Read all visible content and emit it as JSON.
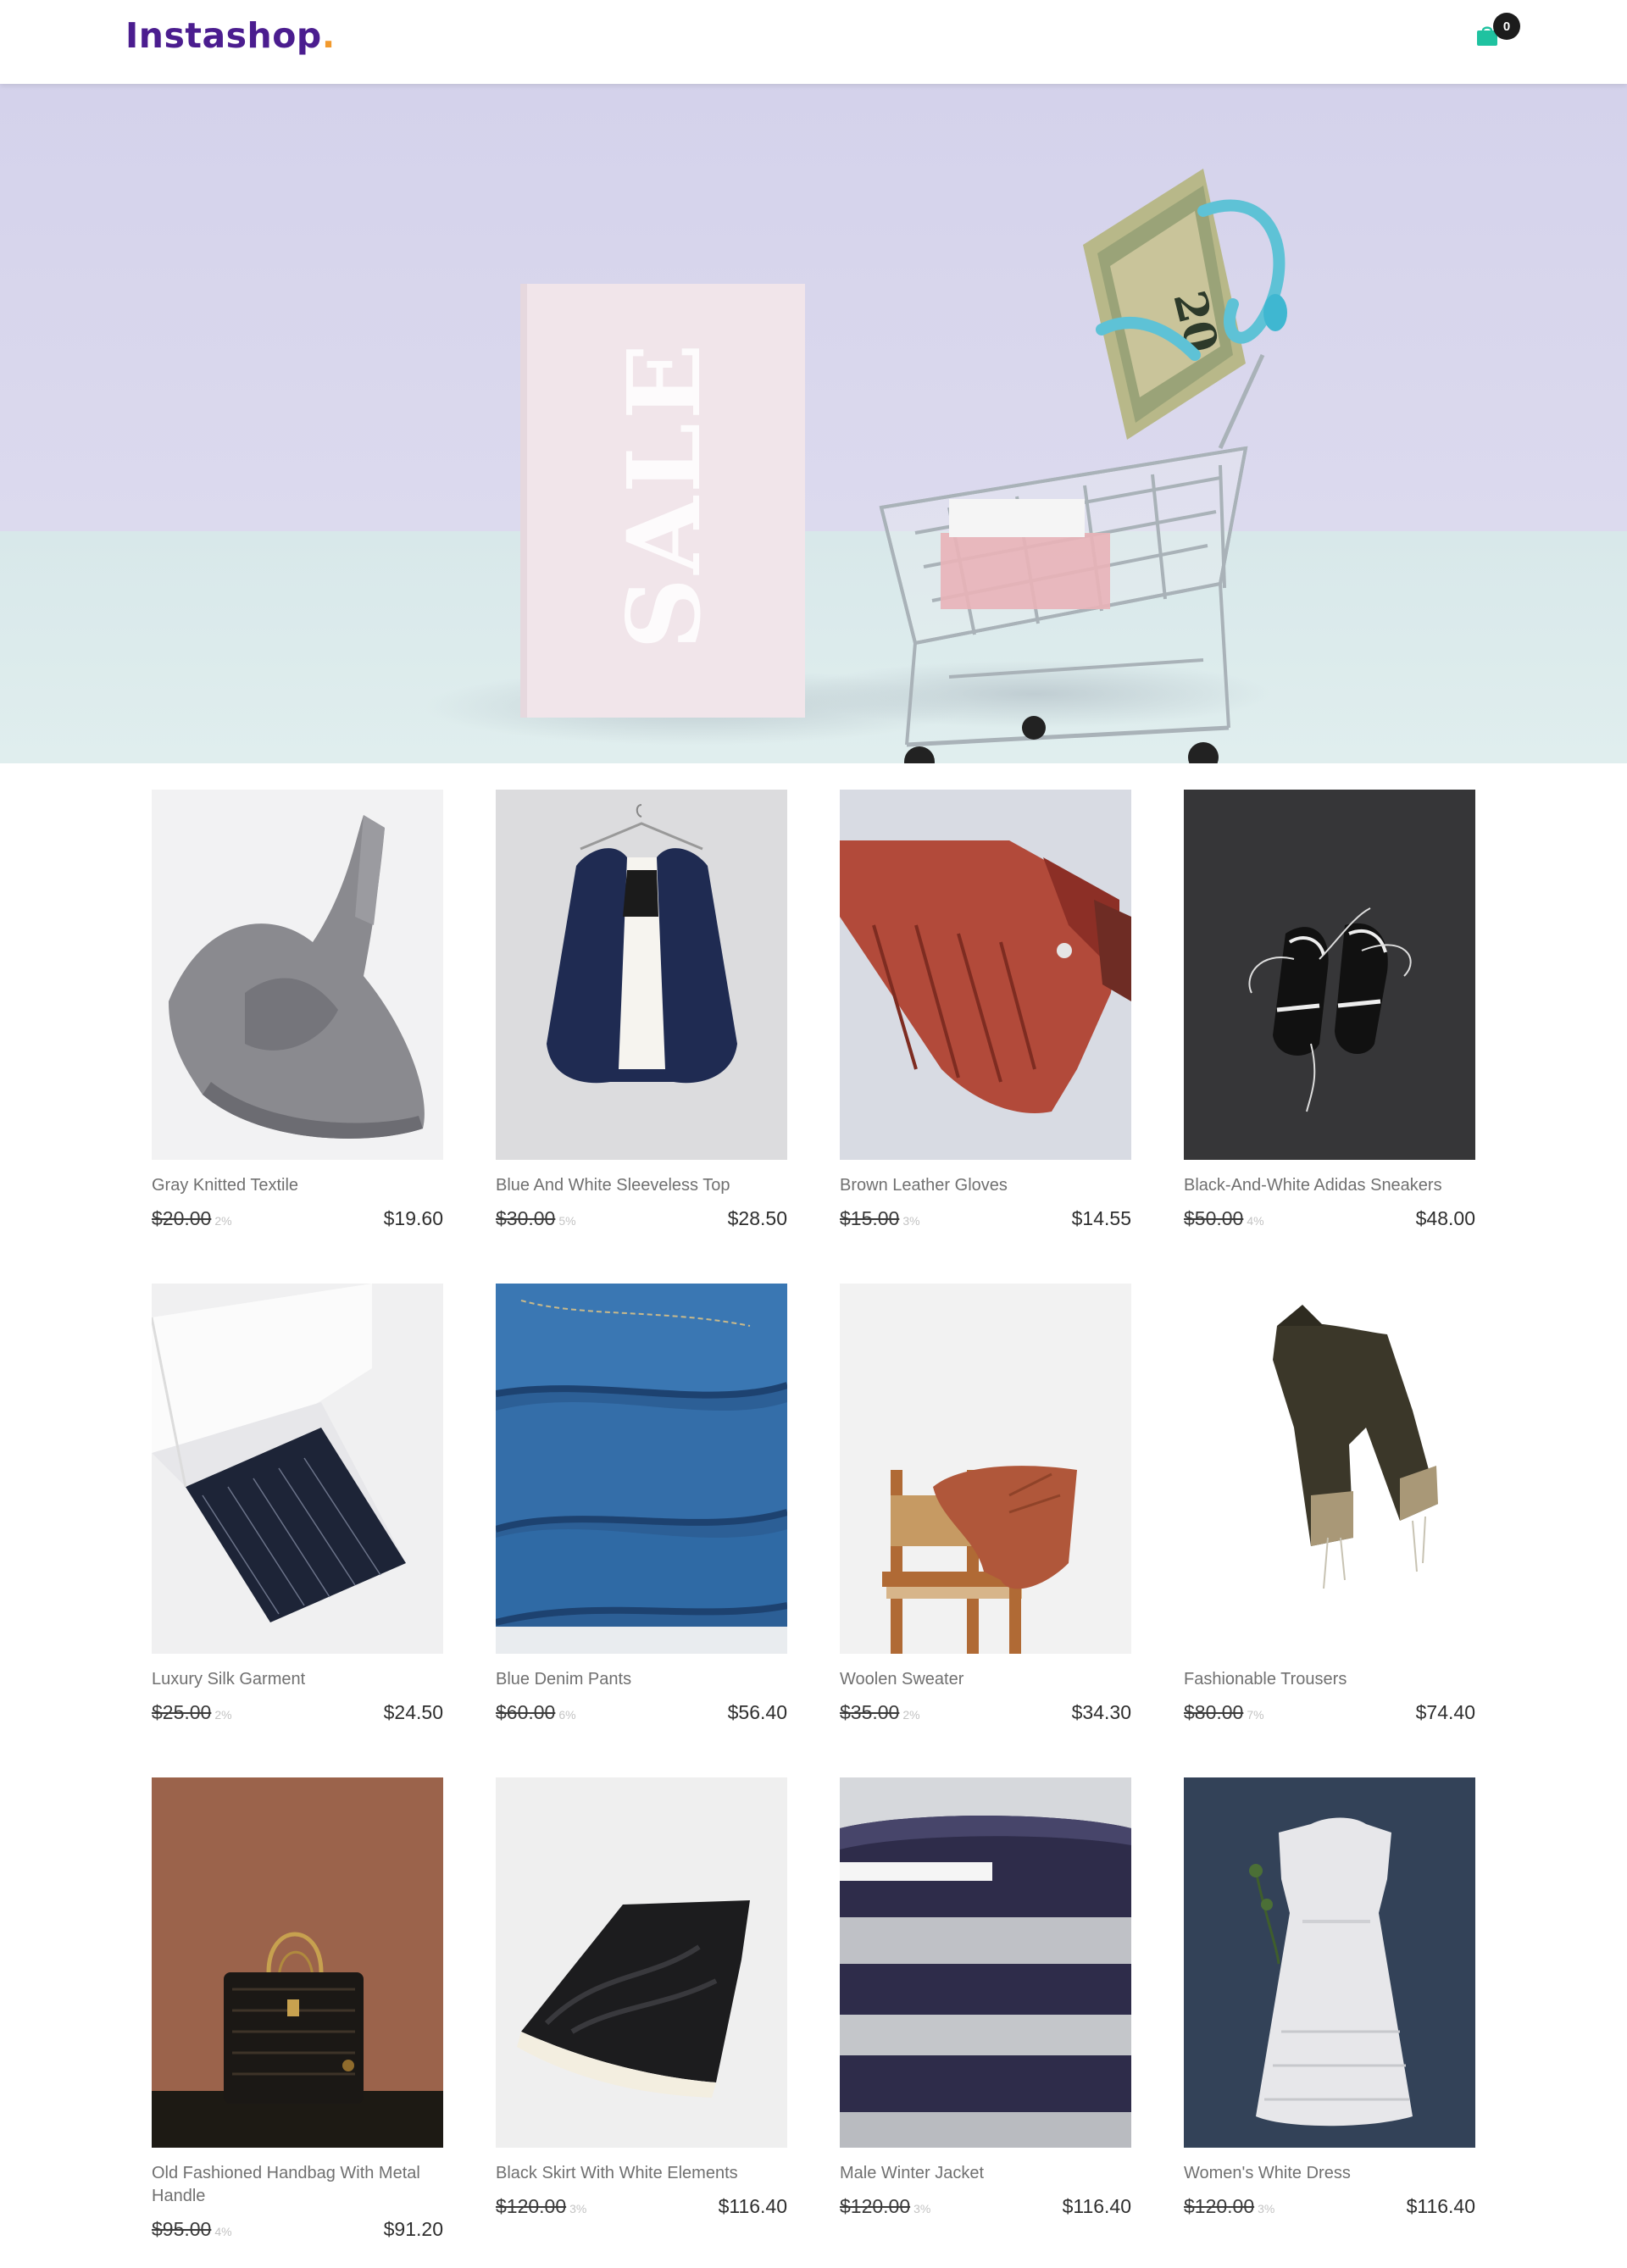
{
  "header": {
    "logo_text": "Instashop",
    "logo_dot": ".",
    "cart_count": "0",
    "cart_icon": "shopping-bag-icon"
  },
  "hero": {
    "sign_text": "SALE",
    "banknote_text": "20"
  },
  "colors": {
    "brand": "#4b1d8f",
    "logo_dot": "#f29a2e",
    "cart": "#1fc2a0",
    "hero_wall": "#d8d6ea",
    "hero_floor": "#dbeaea"
  },
  "products": [
    {
      "name": "Gray Knitted Textile",
      "old_price": "$20.00",
      "discount": "2%",
      "price": "$19.60"
    },
    {
      "name": "Blue And White Sleeveless Top",
      "old_price": "$30.00",
      "discount": "5%",
      "price": "$28.50"
    },
    {
      "name": "Brown Leather Gloves",
      "old_price": "$15.00",
      "discount": "3%",
      "price": "$14.55"
    },
    {
      "name": "Black-And-White Adidas Sneakers",
      "old_price": "$50.00",
      "discount": "4%",
      "price": "$48.00"
    },
    {
      "name": "Luxury Silk Garment",
      "old_price": "$25.00",
      "discount": "2%",
      "price": "$24.50"
    },
    {
      "name": "Blue Denim Pants",
      "old_price": "$60.00",
      "discount": "6%",
      "price": "$56.40"
    },
    {
      "name": "Woolen Sweater",
      "old_price": "$35.00",
      "discount": "2%",
      "price": "$34.30"
    },
    {
      "name": "Fashionable Trousers",
      "old_price": "$80.00",
      "discount": "7%",
      "price": "$74.40"
    },
    {
      "name": "Old Fashioned Handbag With Metal Handle",
      "old_price": "$95.00",
      "discount": "4%",
      "price": "$91.20"
    },
    {
      "name": "Black Skirt With White Elements",
      "old_price": "$120.00",
      "discount": "3%",
      "price": "$116.40"
    },
    {
      "name": "Male Winter Jacket",
      "old_price": "$120.00",
      "discount": "3%",
      "price": "$116.40"
    },
    {
      "name": "Women's White Dress",
      "old_price": "$120.00",
      "discount": "3%",
      "price": "$116.40"
    }
  ]
}
